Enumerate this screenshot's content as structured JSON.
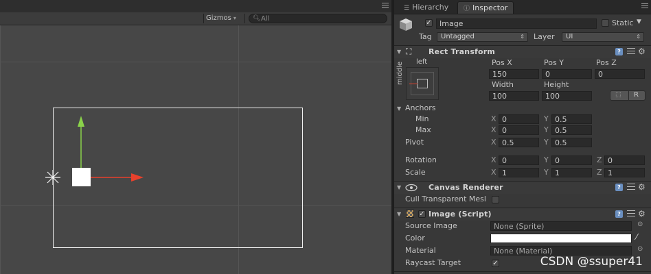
{
  "scene": {
    "gizmos_label": "Gizmos",
    "search_placeholder": "All"
  },
  "inspector": {
    "tabs": [
      {
        "label": "Hierarchy",
        "icon": "list-icon"
      },
      {
        "label": "Inspector",
        "icon": "info-icon"
      }
    ],
    "gameobject": {
      "name": "Image",
      "active": true,
      "static_label": "Static",
      "tag_label": "Tag",
      "tag_value": "Untagged",
      "layer_label": "Layer",
      "layer_value": "UI"
    },
    "rect_transform": {
      "title": "Rect Transform",
      "anchor_h_label": "left",
      "anchor_v_label": "middle",
      "pos_x_label": "Pos X",
      "pos_y_label": "Pos Y",
      "pos_z_label": "Pos Z",
      "pos_x": "150",
      "pos_y": "0",
      "pos_z": "0",
      "width_label": "Width",
      "height_label": "Height",
      "width": "100",
      "height": "100",
      "r_button": "R",
      "anchors_label": "Anchors",
      "min_label": "Min",
      "max_label": "Max",
      "anchor_min_x": "0",
      "anchor_min_y": "0.5",
      "anchor_max_x": "0",
      "anchor_max_y": "0.5",
      "pivot_label": "Pivot",
      "pivot_x": "0.5",
      "pivot_y": "0.5",
      "rotation_label": "Rotation",
      "rotation_x": "0",
      "rotation_y": "0",
      "rotation_z": "0",
      "scale_label": "Scale",
      "scale_x": "1",
      "scale_y": "1",
      "scale_z": "1",
      "x": "X",
      "y": "Y",
      "z": "Z"
    },
    "canvas_renderer": {
      "title": "Canvas Renderer",
      "cull_label": "Cull Transparent Mesl",
      "cull_value": false
    },
    "image_script": {
      "title": "Image (Script)",
      "enabled": true,
      "source_image_label": "Source Image",
      "source_image_value": "None (Sprite)",
      "color_label": "Color",
      "color_value": "#ffffff",
      "material_label": "Material",
      "material_value": "None (Material)",
      "raycast_label": "Raycast Target",
      "raycast_value": true
    }
  },
  "watermark": "CSDN @ssuper41",
  "colors": {
    "accent_y_axis": "#8ad24a",
    "accent_x_axis": "#e8412c",
    "panel_bg": "#383838",
    "scene_bg": "#474747"
  }
}
